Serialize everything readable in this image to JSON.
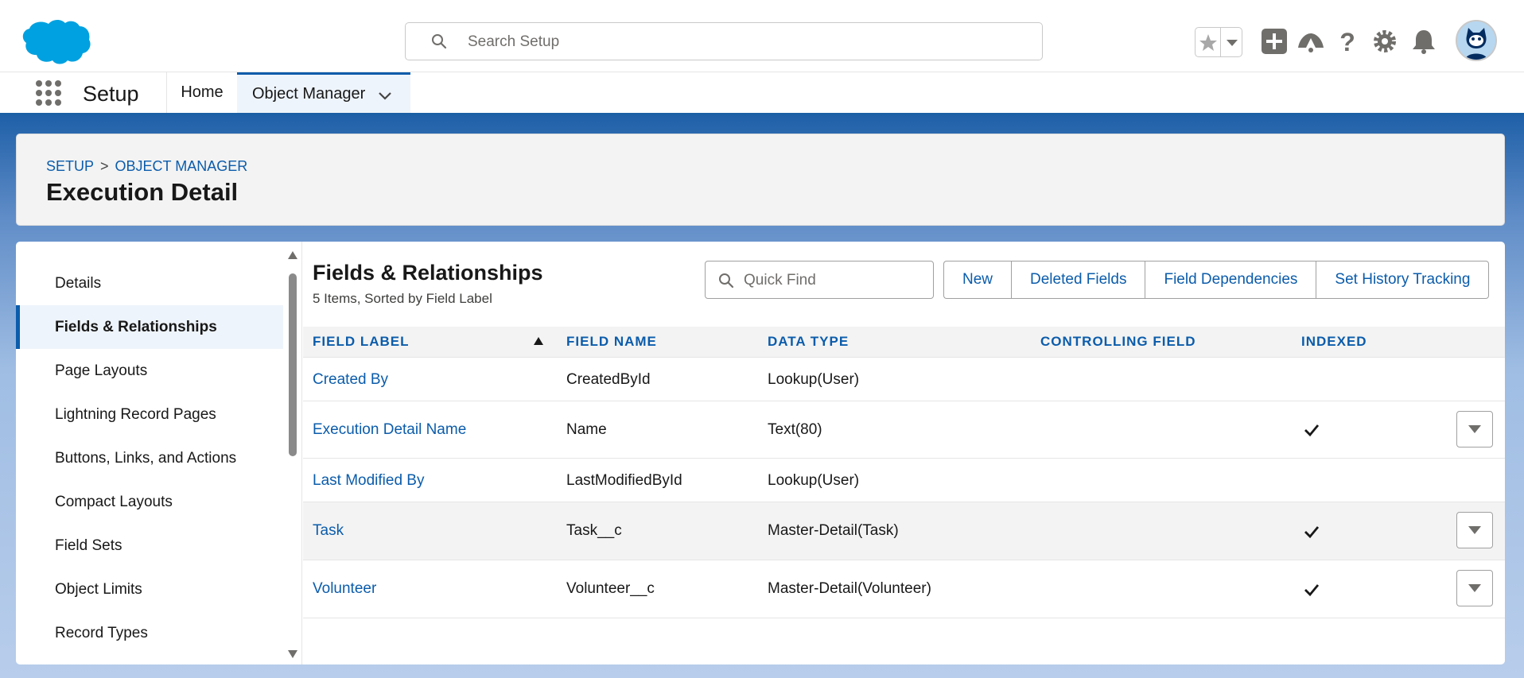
{
  "header": {
    "search_placeholder": "Search Setup",
    "icons": [
      "favorites-star-icon",
      "add-icon",
      "trailhead-icon",
      "help-icon",
      "setup-gear-icon",
      "notifications-bell-icon",
      "avatar"
    ]
  },
  "context_bar": {
    "app_name": "Setup",
    "tabs": [
      {
        "label": "Home"
      },
      {
        "label": "Object Manager"
      }
    ]
  },
  "page_header": {
    "breadcrumb": [
      "SETUP",
      "OBJECT MANAGER"
    ],
    "breadcrumb_separator": ">",
    "title": "Execution Detail"
  },
  "sidebar": {
    "items": [
      {
        "label": "Details"
      },
      {
        "label": "Fields & Relationships"
      },
      {
        "label": "Page Layouts"
      },
      {
        "label": "Lightning Record Pages"
      },
      {
        "label": "Buttons, Links, and Actions"
      },
      {
        "label": "Compact Layouts"
      },
      {
        "label": "Field Sets"
      },
      {
        "label": "Object Limits"
      },
      {
        "label": "Record Types"
      }
    ],
    "active": "Fields & Relationships"
  },
  "fields_section": {
    "title": "Fields & Relationships",
    "subtitle": "5 Items, Sorted by Field Label",
    "quick_find_placeholder": "Quick Find",
    "buttons": [
      "New",
      "Deleted Fields",
      "Field Dependencies",
      "Set History Tracking"
    ],
    "columns": [
      "FIELD LABEL",
      "FIELD NAME",
      "DATA TYPE",
      "CONTROLLING FIELD",
      "INDEXED"
    ],
    "rows": [
      {
        "label": "Created By",
        "name": "CreatedById",
        "type": "Lookup(User)",
        "controlling": "",
        "indexed": false,
        "menu": false
      },
      {
        "label": "Execution Detail Name",
        "name": "Name",
        "type": "Text(80)",
        "controlling": "",
        "indexed": true,
        "menu": true
      },
      {
        "label": "Last Modified By",
        "name": "LastModifiedById",
        "type": "Lookup(User)",
        "controlling": "",
        "indexed": false,
        "menu": false
      },
      {
        "label": "Task",
        "name": "Task__c",
        "type": "Master-Detail(Task)",
        "controlling": "",
        "indexed": true,
        "menu": true
      },
      {
        "label": "Volunteer",
        "name": "Volunteer__c",
        "type": "Master-Detail(Volunteer)",
        "controlling": "",
        "indexed": true,
        "menu": true
      }
    ]
  },
  "colors": {
    "brand_blue": "#0b5cab",
    "salesforce_cloud": "#00a1e0",
    "banner_blue": "#1f60a8"
  }
}
